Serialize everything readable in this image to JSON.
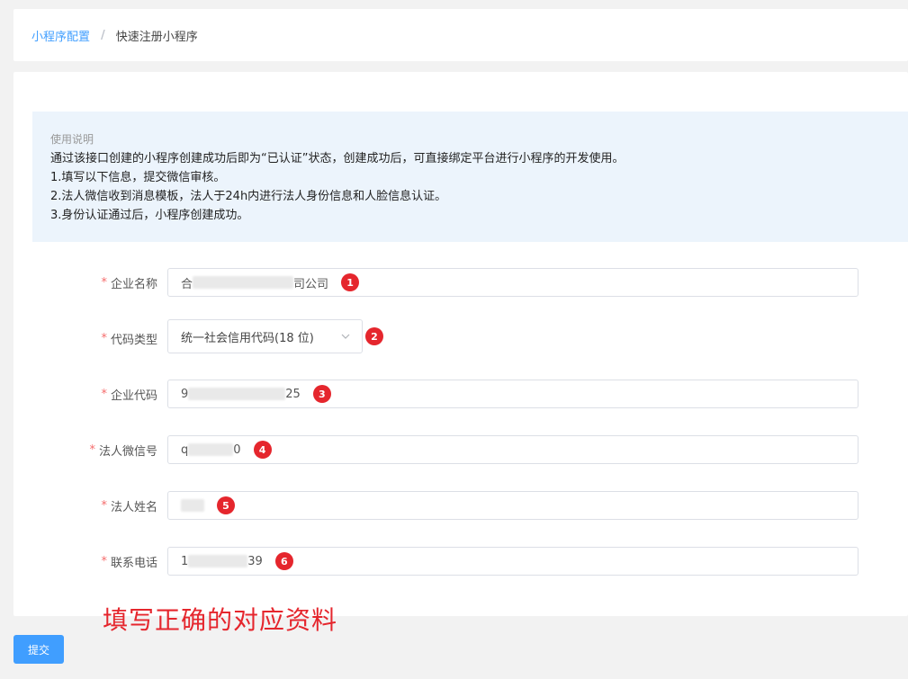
{
  "breadcrumb": {
    "parent": "小程序配置",
    "separator": "/",
    "current": "快速注册小程序"
  },
  "notice": {
    "title": "使用说明",
    "lines": [
      "通过该接口创建的小程序创建成功后即为“已认证”状态，创建成功后，可直接绑定平台进行小程序的开发使用。",
      "1.填写以下信息，提交微信审核。",
      "2.法人微信收到消息模板，法人于24h内进行法人身份信息和人脸信息认证。",
      "3.身份认证通过后，小程序创建成功。"
    ]
  },
  "form": {
    "required_mark": "*",
    "company_name": {
      "label": "企业名称",
      "value_start": "合",
      "value_end": "司公司",
      "badge": "1"
    },
    "code_type": {
      "label": "代码类型",
      "value": "统一社会信用代码(18 位)",
      "badge": "2"
    },
    "company_code": {
      "label": "企业代码",
      "value_start": "9",
      "value_end": "25",
      "badge": "3"
    },
    "legal_wechat": {
      "label": "法人微信号",
      "value_start": "q",
      "value_end": "0",
      "badge": "4"
    },
    "legal_name": {
      "label": "法人姓名",
      "value_start": "",
      "value_end": "",
      "badge": "5"
    },
    "contact_phone": {
      "label": "联系电话",
      "value_start": "1",
      "value_end": "39",
      "badge": "6"
    }
  },
  "annotation": "填写正确的对应资料",
  "submit_label": "提交",
  "colors": {
    "accent": "#409eff",
    "badge": "#e5262d",
    "required": "#f56c6c",
    "notice_bg": "#ecf4fc"
  }
}
